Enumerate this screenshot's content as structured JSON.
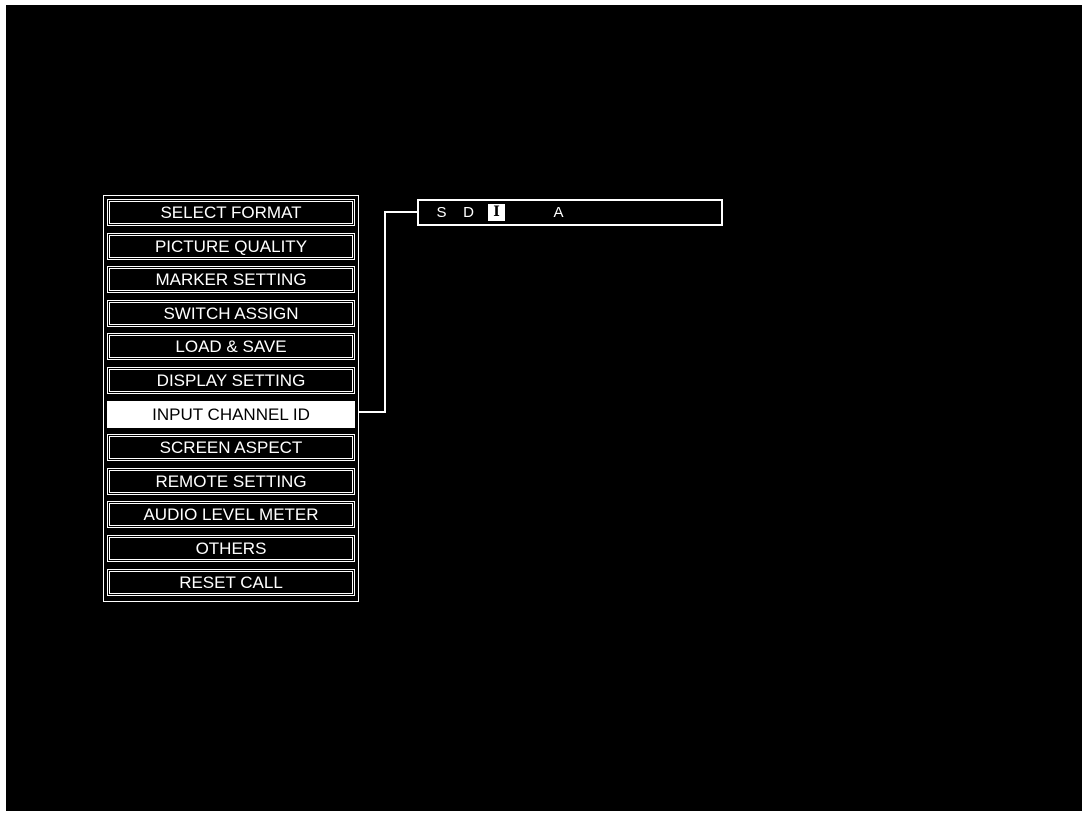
{
  "menu": {
    "items": [
      {
        "label": "SELECT FORMAT"
      },
      {
        "label": "PICTURE QUALITY"
      },
      {
        "label": "MARKER SETTING"
      },
      {
        "label": "SWITCH ASSIGN"
      },
      {
        "label": "LOAD & SAVE"
      },
      {
        "label": "DISPLAY SETTING"
      },
      {
        "label": "INPUT CHANNEL ID",
        "selected": true
      },
      {
        "label": "SCREEN ASPECT"
      },
      {
        "label": "REMOTE SETTING"
      },
      {
        "label": "AUDIO LEVEL METER"
      },
      {
        "label": "OTHERS"
      },
      {
        "label": "RESET CALL"
      }
    ]
  },
  "channel_id": {
    "chars": [
      "S",
      "D",
      "I",
      "A"
    ]
  },
  "colors": {
    "background": "#000000",
    "foreground": "#ffffff"
  }
}
